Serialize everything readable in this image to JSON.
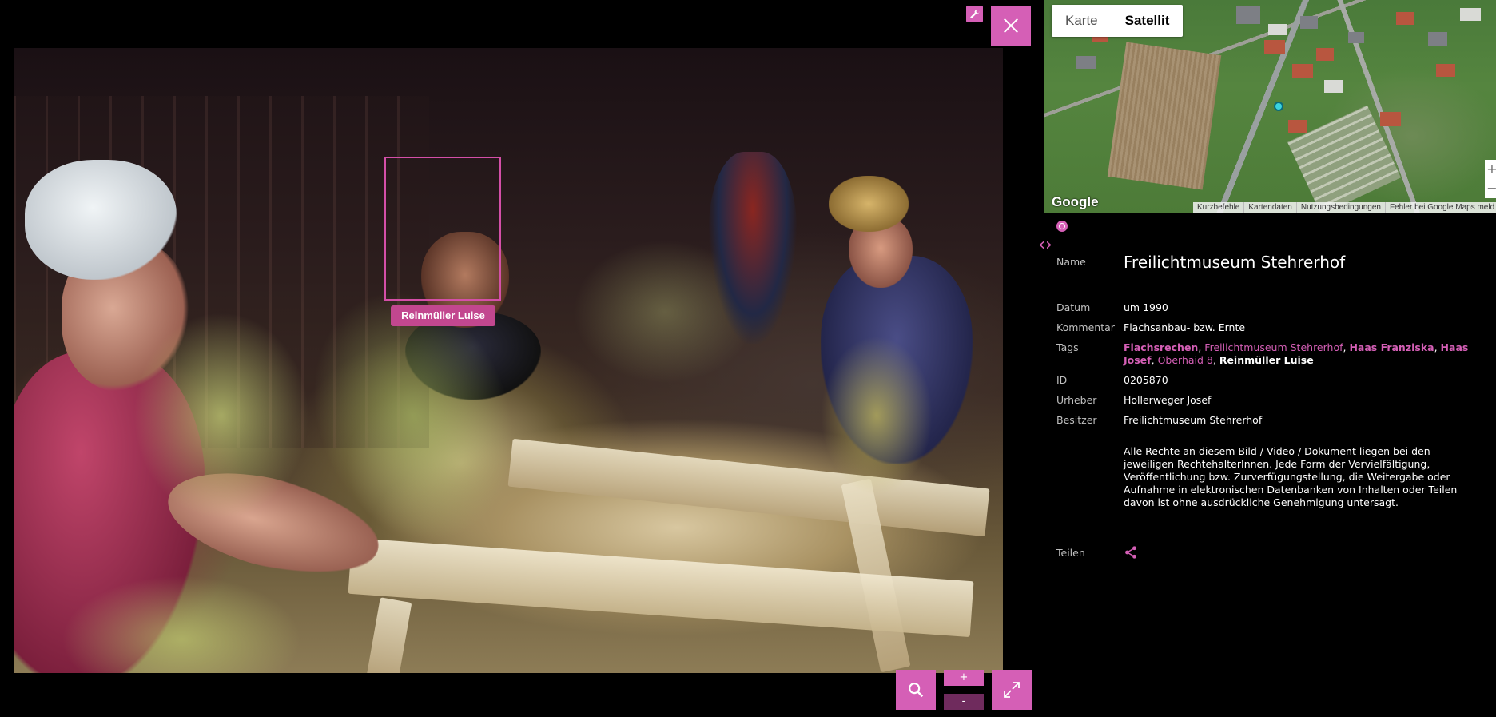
{
  "viewer": {
    "face_label": "Reinmüller Luise",
    "zoom_in_label": "+",
    "zoom_out_label": "-",
    "icons": {
      "wrench": "wrench-icon",
      "close": "close-icon",
      "search": "search-icon",
      "fullscreen": "fullscreen-icon"
    }
  },
  "map": {
    "tabs": [
      "Karte",
      "Satellit"
    ],
    "active_tab": "Satellit",
    "logo": "Google",
    "footer": [
      "Kurzbefehle",
      "Kartendaten",
      "Nutzungsbedingungen",
      "Fehler bei Google Maps meld"
    ],
    "zoom_in": "+",
    "zoom_out": "−"
  },
  "panel_toggle": "‹›",
  "details": {
    "name_label": "Name",
    "name_value": "Freilichtmuseum Stehrerhof",
    "datum_label": "Datum",
    "datum_value": "um 1990",
    "kommentar_label": "Kommentar",
    "kommentar_value": "Flachsanbau- bzw. Ernte",
    "tags_label": "Tags",
    "tags": [
      {
        "text": "Flachsrechen",
        "style": "bold"
      },
      {
        "text": "Freilichtmuseum Stehrerhof",
        "style": "normal"
      },
      {
        "text": "Haas Franziska",
        "style": "bold"
      },
      {
        "text": "Haas Josef",
        "style": "bold"
      },
      {
        "text": "Oberhaid 8",
        "style": "normal"
      },
      {
        "text": "Reinmüller Luise",
        "style": "white"
      }
    ],
    "id_label": "ID",
    "id_value": "0205870",
    "urheber_label": "Urheber",
    "urheber_value": "Hollerweger Josef",
    "besitzer_label": "Besitzer",
    "besitzer_value": "Freilichtmuseum Stehrerhof",
    "rights_text": "Alle Rechte an diesem Bild / Video / Dokument liegen bei den jeweiligen RechtehalterInnen. Jede Form der Vervielfältigung, Veröffentlichung bzw. Zurverfügungstellung, die Weitergabe oder Aufnahme in elektronischen Datenbanken von Inhalten oder Teilen davon ist ohne ausdrückliche Genehmigung untersagt.",
    "teilen_label": "Teilen"
  },
  "colors": {
    "accent": "#d55fb6",
    "face_label_bg": "#c2478f",
    "background": "#000000"
  }
}
